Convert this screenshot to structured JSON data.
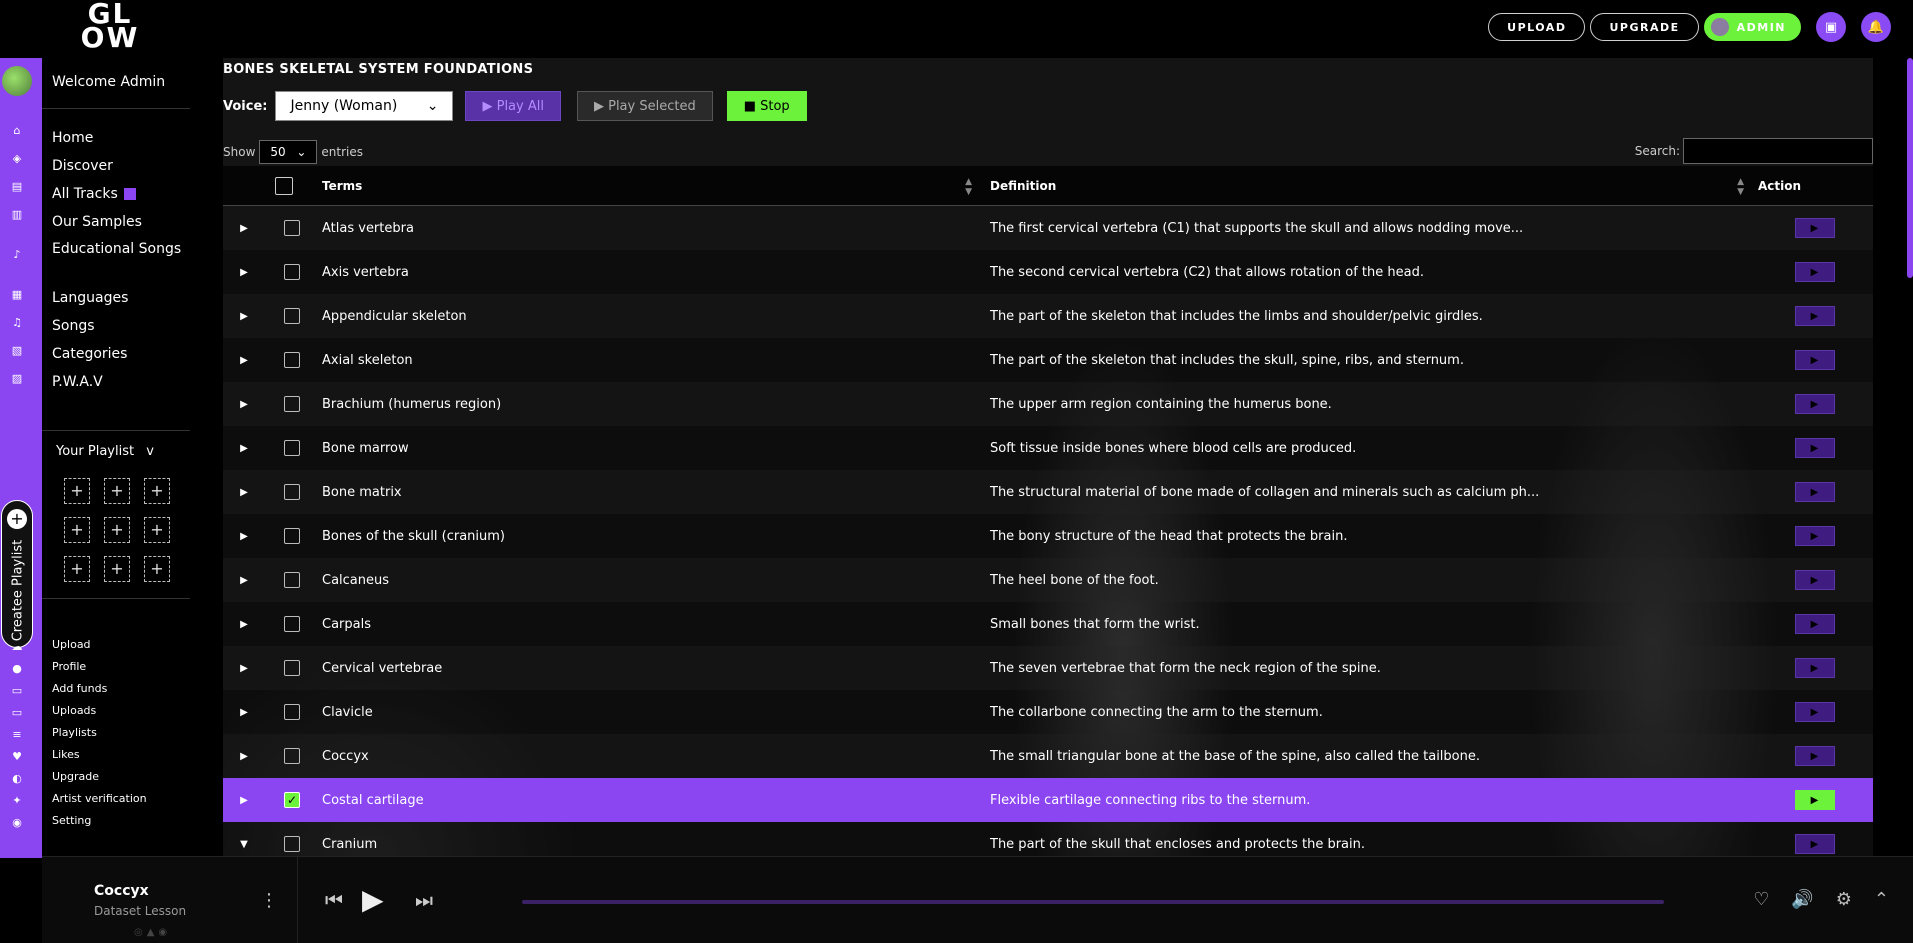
{
  "brand": {
    "logo_line1": "GL",
    "logo_line2": "OW"
  },
  "topbar": {
    "upload": "UPLOAD",
    "upgrade": "UPGRADE",
    "admin": "ADMIN"
  },
  "sidebar": {
    "welcome": "Welcome Admin",
    "nav": [
      "Home",
      "Discover",
      "All Tracks",
      "Our Samples",
      "Educational Songs",
      "Languages",
      "Songs",
      "Categories",
      "P.W.A.V"
    ],
    "your_playlist": "Your Playlist",
    "your_playlist_caret": "v",
    "create_playlist": "Createe Playlist",
    "sub_nav": [
      "Upload",
      "Profile",
      "Add funds",
      "Uploads",
      "Playlists",
      "Likes",
      "Upgrade",
      "Artist verification",
      "Setting"
    ]
  },
  "main": {
    "title": "BONES SKELETAL SYSTEM FOUNDATIONS",
    "voice_label": "Voice:",
    "voice_value": "Jenny (Woman)",
    "play_all": "▶ Play All",
    "play_selected": "▶ Play Selected",
    "stop": "■ Stop",
    "show_label": "Show",
    "show_value": "50",
    "entries_label": "entries",
    "search_label": "Search:",
    "columns": {
      "terms": "Terms",
      "definition": "Definition",
      "action": "Action"
    },
    "rows": [
      {
        "term": "Atlas vertebra",
        "definition": "The first cervical vertebra (C1) that supports the skull and allows nodding move..."
      },
      {
        "term": "Axis vertebra",
        "definition": "The second cervical vertebra (C2) that allows rotation of the head."
      },
      {
        "term": "Appendicular skeleton",
        "definition": "The part of the skeleton that includes the limbs and shoulder/pelvic girdles."
      },
      {
        "term": "Axial skeleton",
        "definition": "The part of the skeleton that includes the skull, spine, ribs, and sternum."
      },
      {
        "term": "Brachium (humerus region)",
        "definition": "The upper arm region containing the humerus bone."
      },
      {
        "term": "Bone marrow",
        "definition": "Soft tissue inside bones where blood cells are produced."
      },
      {
        "term": "Bone matrix",
        "definition": "The structural material of bone made of collagen and minerals such as calcium ph..."
      },
      {
        "term": "Bones of the skull (cranium)",
        "definition": "The bony structure of the head that protects the brain."
      },
      {
        "term": "Calcaneus",
        "definition": "The heel bone of the foot."
      },
      {
        "term": "Carpals",
        "definition": "Small bones that form the wrist."
      },
      {
        "term": "Cervical vertebrae",
        "definition": "The seven vertebrae that form the neck region of the spine."
      },
      {
        "term": "Clavicle",
        "definition": "The collarbone connecting the arm to the sternum."
      },
      {
        "term": "Coccyx",
        "definition": "The small triangular bone at the base of the spine, also called the tailbone."
      },
      {
        "term": "Costal cartilage",
        "definition": "Flexible cartilage connecting ribs to the sternum."
      },
      {
        "term": "Cranium",
        "definition": "The part of the skull that encloses and protects the brain."
      }
    ]
  },
  "player": {
    "track_title": "Coccyx",
    "track_subtitle": "Dataset Lesson"
  },
  "colors": {
    "accent_purple": "#8b46f2",
    "accent_green": "#6df23c"
  }
}
